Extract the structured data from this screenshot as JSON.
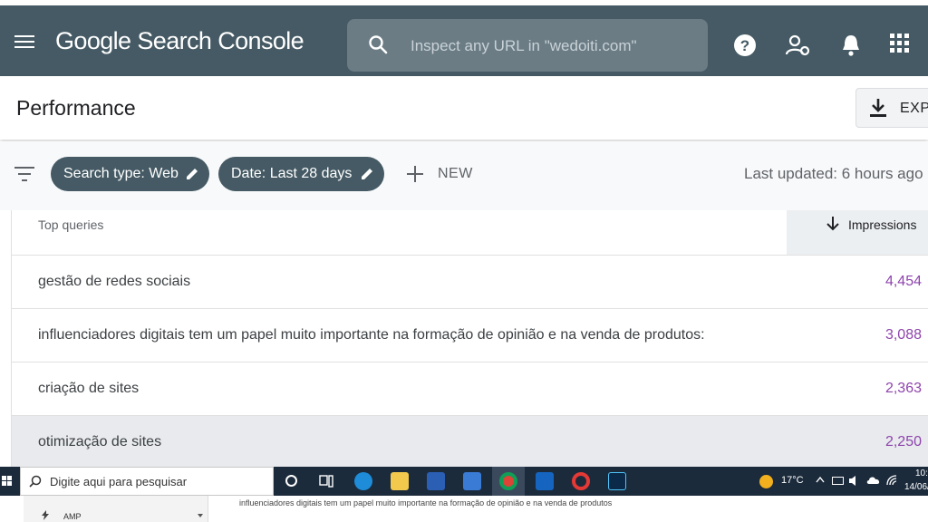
{
  "app": {
    "brand": "Google Search Console",
    "search_placeholder": "Inspect any URL in \"wedoiti.com\""
  },
  "header": {
    "title": "Performance",
    "export_label": "EXP"
  },
  "filters": {
    "chips": [
      "Search type: Web",
      "Date: Last 28 days"
    ],
    "new_label": "NEW",
    "last_updated": "Last updated: 6 hours ago"
  },
  "table": {
    "col_query": "Top queries",
    "col_impressions": "Impressions",
    "rows": [
      {
        "query": "gestão de redes sociais",
        "impressions": "4,454"
      },
      {
        "query": "influenciadores digitais tem um papel muito importante na formação de opinião e na venda de produtos:",
        "impressions": "3,088"
      },
      {
        "query": "criação de sites",
        "impressions": "2,363"
      },
      {
        "query": "otimização de sites",
        "impressions": "2,250"
      }
    ]
  },
  "taskbar": {
    "search_text": "Digite aqui para pesquisar",
    "temperature": "17°C",
    "time": "10:",
    "date": "14/06/"
  },
  "under": {
    "amp_label": "AMP",
    "snippet": "influenciadores digitais tem um papel muito importante na formação de opinião e na venda de produtos"
  },
  "colors": {
    "appbar": "#455a64",
    "impressions_value": "#8e44ad"
  }
}
